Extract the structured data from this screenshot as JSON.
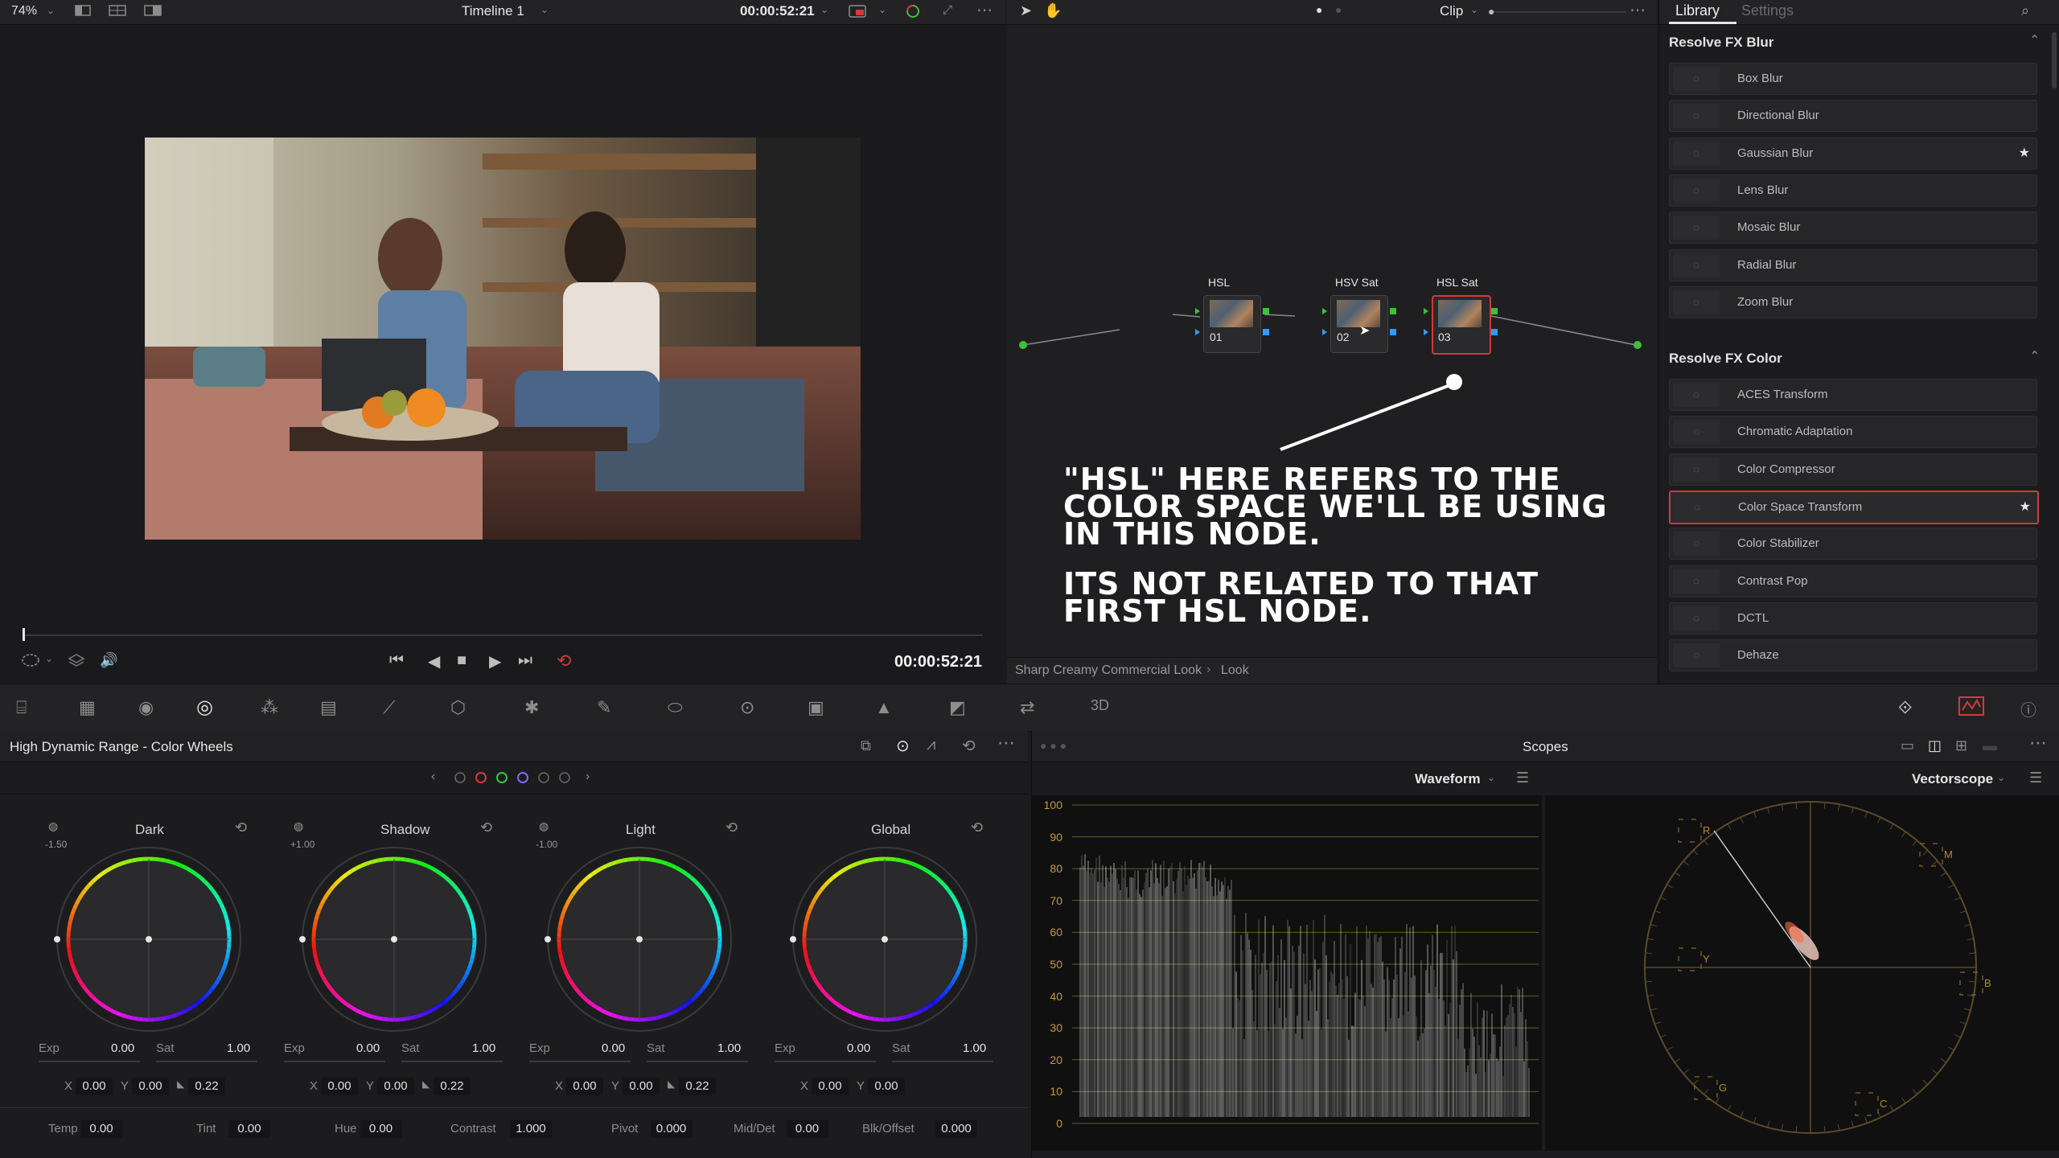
{
  "viewer": {
    "zoom": "74%",
    "timeline": "Timeline 1",
    "timecode_top": "00:00:52:21",
    "timecode_bottom": "00:00:52:21"
  },
  "nodes": {
    "mode": "Clip",
    "items": [
      {
        "label": "HSL",
        "num": "01"
      },
      {
        "label": "HSV Sat",
        "num": "02"
      },
      {
        "label": "HSL Sat",
        "num": "03"
      }
    ],
    "annotation_line1": "\"HSL\" here refers to the color space we'll be using in this node.",
    "annotation_line2": "Its not related to that first HSL node.",
    "breadcrumb": [
      "Sharp Creamy Commercial Look",
      "Look"
    ]
  },
  "library": {
    "tab_active": "Library",
    "tab_inactive": "Settings",
    "sections": [
      {
        "title": "Resolve FX Blur",
        "items": [
          {
            "label": "Box Blur",
            "starred": false,
            "selected": false
          },
          {
            "label": "Directional Blur",
            "starred": false,
            "selected": false
          },
          {
            "label": "Gaussian Blur",
            "starred": true,
            "selected": false
          },
          {
            "label": "Lens Blur",
            "starred": false,
            "selected": false
          },
          {
            "label": "Mosaic Blur",
            "starred": false,
            "selected": false
          },
          {
            "label": "Radial Blur",
            "starred": false,
            "selected": false
          },
          {
            "label": "Zoom Blur",
            "starred": false,
            "selected": false
          }
        ]
      },
      {
        "title": "Resolve FX Color",
        "items": [
          {
            "label": "ACES Transform",
            "starred": false,
            "selected": false
          },
          {
            "label": "Chromatic Adaptation",
            "starred": false,
            "selected": false
          },
          {
            "label": "Color Compressor",
            "starred": false,
            "selected": false
          },
          {
            "label": "Color Space Transform",
            "starred": true,
            "selected": true
          },
          {
            "label": "Color Stabilizer",
            "starred": false,
            "selected": false
          },
          {
            "label": "Contrast Pop",
            "starred": false,
            "selected": false
          },
          {
            "label": "DCTL",
            "starred": false,
            "selected": false
          },
          {
            "label": "Dehaze",
            "starred": false,
            "selected": false
          }
        ]
      }
    ]
  },
  "wheels_panel": {
    "title": "High Dynamic Range - Color Wheels",
    "wheels": [
      {
        "name": "Dark",
        "zone": "-1.50",
        "exp": "0.00",
        "sat": "1.00",
        "x": "0.00",
        "y": "0.00",
        "z": "0.22"
      },
      {
        "name": "Shadow",
        "zone": "+1.00",
        "exp": "0.00",
        "sat": "1.00",
        "x": "0.00",
        "y": "0.00",
        "z": "0.22"
      },
      {
        "name": "Light",
        "zone": "-1.00",
        "exp": "0.00",
        "sat": "1.00",
        "x": "0.00",
        "y": "0.00",
        "z": "0.22"
      },
      {
        "name": "Global",
        "zone": "",
        "exp": "0.00",
        "sat": "1.00",
        "x": "0.00",
        "y": "0.00",
        "z": ""
      }
    ],
    "exp_label": "Exp",
    "sat_label": "Sat",
    "x_label": "X",
    "y_label": "Y",
    "bottom": [
      {
        "label": "Temp",
        "value": "0.00"
      },
      {
        "label": "Tint",
        "value": "0.00"
      },
      {
        "label": "Hue",
        "value": "0.00"
      },
      {
        "label": "Contrast",
        "value": "1.000"
      },
      {
        "label": "Pivot",
        "value": "0.000"
      },
      {
        "label": "Mid/Det",
        "value": "0.00"
      },
      {
        "label": "Blk/Offset",
        "value": "0.000"
      }
    ]
  },
  "scopes": {
    "title": "Scopes",
    "left_scope": "Waveform",
    "right_scope": "Vectorscope",
    "waveform_scale": [
      "100",
      "90",
      "80",
      "70",
      "60",
      "50",
      "40",
      "30",
      "20",
      "10",
      "0"
    ],
    "vector_targets": [
      "R",
      "M",
      "B",
      "C",
      "G",
      "Y"
    ]
  },
  "colors": {
    "accent_red": "#d23a3a",
    "node_green": "#3fbf3f",
    "node_blue": "#2f9bff",
    "scope_orange": "#c89a3a"
  }
}
